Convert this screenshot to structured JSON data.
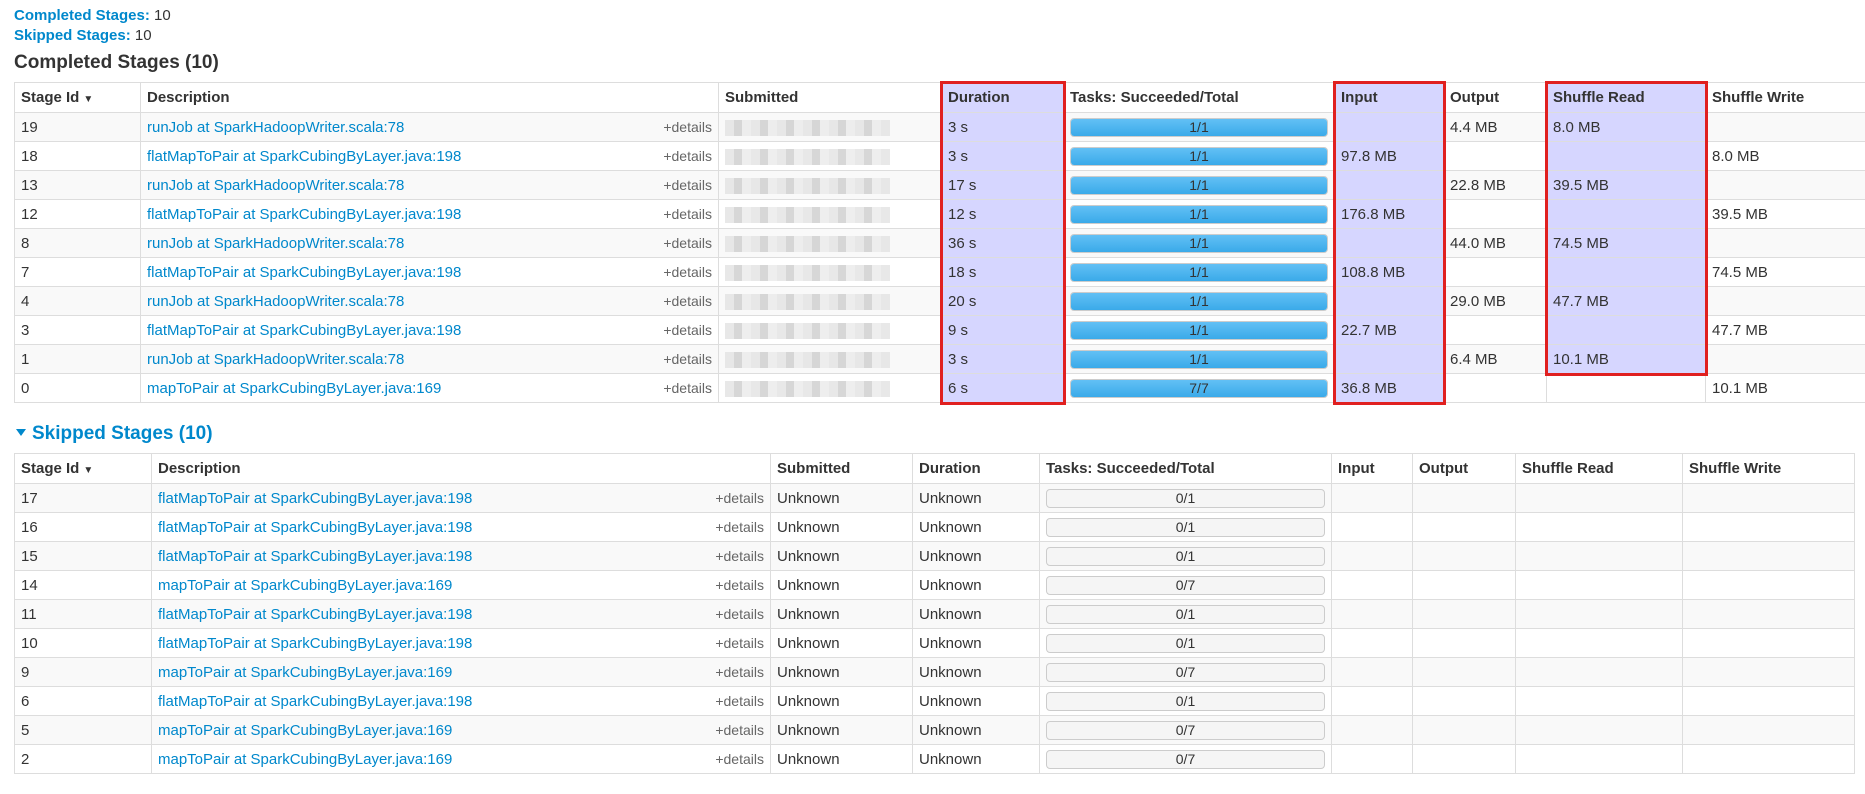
{
  "summary": {
    "completed_label": "Completed Stages:",
    "completed_value": "10",
    "skipped_label": "Skipped Stages:",
    "skipped_value": "10"
  },
  "completed": {
    "title": "Completed Stages (10)",
    "headers": [
      "Stage Id",
      "Description",
      "Submitted",
      "Duration",
      "Tasks: Succeeded/Total",
      "Input",
      "Output",
      "Shuffle Read",
      "Shuffle Write"
    ],
    "sort_glyph": "▼",
    "details_label": "+details",
    "rows": [
      {
        "id": "19",
        "desc": "runJob at SparkHadoopWriter.scala:78",
        "duration": "3 s",
        "tasks": "1/1",
        "progress": 1,
        "input": "",
        "output": "4.4 MB",
        "sread": "8.0 MB",
        "swrite": ""
      },
      {
        "id": "18",
        "desc": "flatMapToPair at SparkCubingByLayer.java:198",
        "duration": "3 s",
        "tasks": "1/1",
        "progress": 1,
        "input": "97.8 MB",
        "output": "",
        "sread": "",
        "swrite": "8.0 MB"
      },
      {
        "id": "13",
        "desc": "runJob at SparkHadoopWriter.scala:78",
        "duration": "17 s",
        "tasks": "1/1",
        "progress": 1,
        "input": "",
        "output": "22.8 MB",
        "sread": "39.5 MB",
        "swrite": ""
      },
      {
        "id": "12",
        "desc": "flatMapToPair at SparkCubingByLayer.java:198",
        "duration": "12 s",
        "tasks": "1/1",
        "progress": 1,
        "input": "176.8 MB",
        "output": "",
        "sread": "",
        "swrite": "39.5 MB"
      },
      {
        "id": "8",
        "desc": "runJob at SparkHadoopWriter.scala:78",
        "duration": "36 s",
        "tasks": "1/1",
        "progress": 1,
        "input": "",
        "output": "44.0 MB",
        "sread": "74.5 MB",
        "swrite": ""
      },
      {
        "id": "7",
        "desc": "flatMapToPair at SparkCubingByLayer.java:198",
        "duration": "18 s",
        "tasks": "1/1",
        "progress": 1,
        "input": "108.8 MB",
        "output": "",
        "sread": "",
        "swrite": "74.5 MB"
      },
      {
        "id": "4",
        "desc": "runJob at SparkHadoopWriter.scala:78",
        "duration": "20 s",
        "tasks": "1/1",
        "progress": 1,
        "input": "",
        "output": "29.0 MB",
        "sread": "47.7 MB",
        "swrite": ""
      },
      {
        "id": "3",
        "desc": "flatMapToPair at SparkCubingByLayer.java:198",
        "duration": "9 s",
        "tasks": "1/1",
        "progress": 1,
        "input": "22.7 MB",
        "output": "",
        "sread": "",
        "swrite": "47.7 MB"
      },
      {
        "id": "1",
        "desc": "runJob at SparkHadoopWriter.scala:78",
        "duration": "3 s",
        "tasks": "1/1",
        "progress": 1,
        "input": "",
        "output": "6.4 MB",
        "sread": "10.1 MB",
        "swrite": ""
      },
      {
        "id": "0",
        "desc": "mapToPair at SparkCubingByLayer.java:169",
        "duration": "6 s",
        "tasks": "7/7",
        "progress": 1,
        "input": "36.8 MB",
        "output": "",
        "sread": "",
        "swrite": "10.1 MB"
      }
    ]
  },
  "skipped": {
    "title": "Skipped Stages (10)",
    "headers": [
      "Stage Id",
      "Description",
      "Submitted",
      "Duration",
      "Tasks: Succeeded/Total",
      "Input",
      "Output",
      "Shuffle Read",
      "Shuffle Write"
    ],
    "sort_glyph": "▼",
    "details_label": "+details",
    "rows": [
      {
        "id": "17",
        "desc": "flatMapToPair at SparkCubingByLayer.java:198",
        "submitted": "Unknown",
        "duration": "Unknown",
        "tasks": "0/1",
        "progress": 0
      },
      {
        "id": "16",
        "desc": "flatMapToPair at SparkCubingByLayer.java:198",
        "submitted": "Unknown",
        "duration": "Unknown",
        "tasks": "0/1",
        "progress": 0
      },
      {
        "id": "15",
        "desc": "flatMapToPair at SparkCubingByLayer.java:198",
        "submitted": "Unknown",
        "duration": "Unknown",
        "tasks": "0/1",
        "progress": 0
      },
      {
        "id": "14",
        "desc": "mapToPair at SparkCubingByLayer.java:169",
        "submitted": "Unknown",
        "duration": "Unknown",
        "tasks": "0/7",
        "progress": 0
      },
      {
        "id": "11",
        "desc": "flatMapToPair at SparkCubingByLayer.java:198",
        "submitted": "Unknown",
        "duration": "Unknown",
        "tasks": "0/1",
        "progress": 0
      },
      {
        "id": "10",
        "desc": "flatMapToPair at SparkCubingByLayer.java:198",
        "submitted": "Unknown",
        "duration": "Unknown",
        "tasks": "0/1",
        "progress": 0
      },
      {
        "id": "9",
        "desc": "mapToPair at SparkCubingByLayer.java:169",
        "submitted": "Unknown",
        "duration": "Unknown",
        "tasks": "0/7",
        "progress": 0
      },
      {
        "id": "6",
        "desc": "flatMapToPair at SparkCubingByLayer.java:198",
        "submitted": "Unknown",
        "duration": "Unknown",
        "tasks": "0/1",
        "progress": 0
      },
      {
        "id": "5",
        "desc": "mapToPair at SparkCubingByLayer.java:169",
        "submitted": "Unknown",
        "duration": "Unknown",
        "tasks": "0/7",
        "progress": 0
      },
      {
        "id": "2",
        "desc": "mapToPair at SparkCubingByLayer.java:169",
        "submitted": "Unknown",
        "duration": "Unknown",
        "tasks": "0/7",
        "progress": 0
      }
    ]
  },
  "colors": {
    "link": "#0088cc",
    "highlight": "#b4b4ff",
    "annotation_box": "#e02020",
    "progress_bar": "#3aaae9"
  }
}
